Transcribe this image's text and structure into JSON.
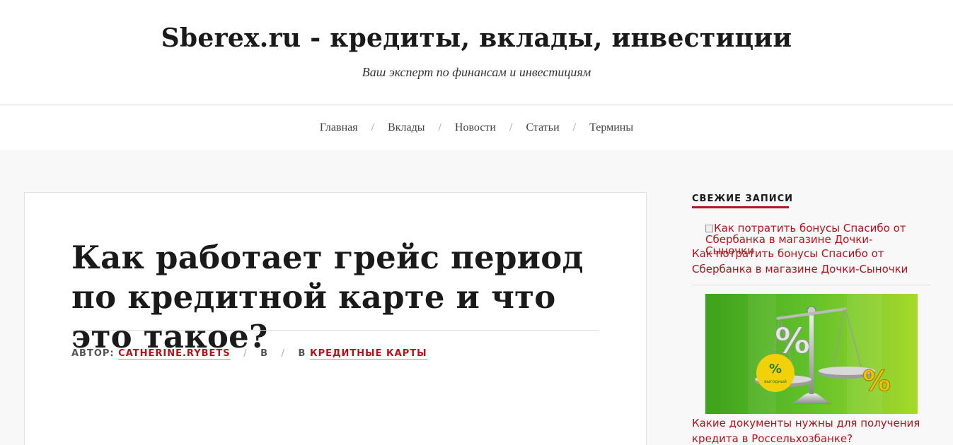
{
  "header": {
    "site_title": "Sberex.ru - кредиты, вклады, инвестиции",
    "tagline": "Ваш эксперт по финансам и инвестициям"
  },
  "nav": {
    "items": [
      "Главная",
      "Вклады",
      "Новости",
      "Статьи",
      "Термины"
    ],
    "separator": "/"
  },
  "article": {
    "title": "Как работает грейс период по кредитной карте и что это такое?",
    "meta": {
      "author_label": "АВТОР:",
      "author": "CATHERINE.RYBETS",
      "in_label": "В",
      "category_label": "В",
      "category": "КРЕДИТНЫЕ КАРТЫ"
    }
  },
  "sidebar": {
    "widget_title": "СВЕЖИЕ ЗАПИСИ",
    "posts": [
      {
        "image_alt": "Как потратить бонусы Спасибо от Сбербанка в магазине Дочки-Сыночки",
        "title": "Как потратить бонусы Спасибо от Сбербанка в магазине Дочки-Сыночки"
      },
      {
        "image_badge": "выгодный",
        "image_percent": "%",
        "title": "Какие документы нужны для получения кредита в Россельхозбанке?"
      }
    ]
  },
  "colors": {
    "accent": "#b5121b",
    "background": "#f8f8f8",
    "header_bg": "#ffffff",
    "thumb_green": "#4caf1e"
  }
}
